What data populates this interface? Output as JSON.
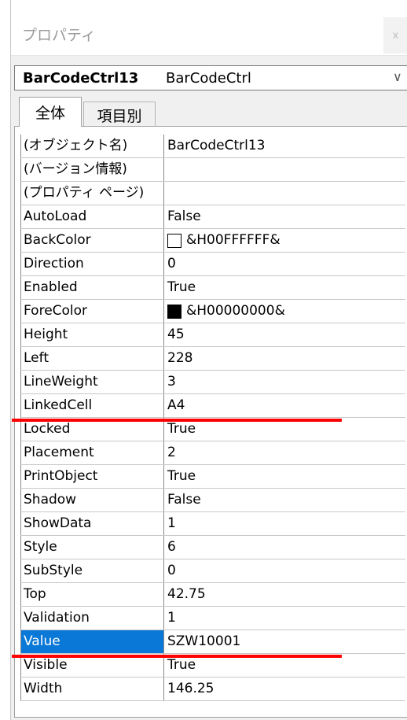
{
  "window": {
    "title": "プロパティ",
    "close_label": "x"
  },
  "object_selector": {
    "name": "BarCodeCtrl13",
    "type": "BarCodeCtrl",
    "chevron": "∨"
  },
  "tabs": [
    {
      "label": "全体"
    },
    {
      "label": "項目別"
    }
  ],
  "properties": [
    {
      "name": "(オブジェクト名)",
      "value": "BarCodeCtrl13"
    },
    {
      "name": "(バージョン情報)",
      "value": ""
    },
    {
      "name": "(プロパティ ページ)",
      "value": ""
    },
    {
      "name": "AutoLoad",
      "value": "False"
    },
    {
      "name": "BackColor",
      "value": "&H00FFFFFF&",
      "swatch": "#ffffff"
    },
    {
      "name": "Direction",
      "value": "0"
    },
    {
      "name": "Enabled",
      "value": "True"
    },
    {
      "name": "ForeColor",
      "value": "&H00000000&",
      "swatch": "#000000"
    },
    {
      "name": "Height",
      "value": "45"
    },
    {
      "name": "Left",
      "value": "228"
    },
    {
      "name": "LineWeight",
      "value": "3"
    },
    {
      "name": "LinkedCell",
      "value": "A4"
    },
    {
      "name": "Locked",
      "value": "True"
    },
    {
      "name": "Placement",
      "value": "2"
    },
    {
      "name": "PrintObject",
      "value": "True"
    },
    {
      "name": "Shadow",
      "value": "False"
    },
    {
      "name": "ShowData",
      "value": "1"
    },
    {
      "name": "Style",
      "value": "6"
    },
    {
      "name": "SubStyle",
      "value": "0"
    },
    {
      "name": "Top",
      "value": "42.75"
    },
    {
      "name": "Validation",
      "value": "1"
    },
    {
      "name": "Value",
      "value": "SZW10001",
      "selected": true
    },
    {
      "name": "Visible",
      "value": "True"
    },
    {
      "name": "Width",
      "value": "146.25"
    }
  ],
  "colors": {
    "selection": "#0a78d7",
    "highlight_line": "#ff0000"
  }
}
